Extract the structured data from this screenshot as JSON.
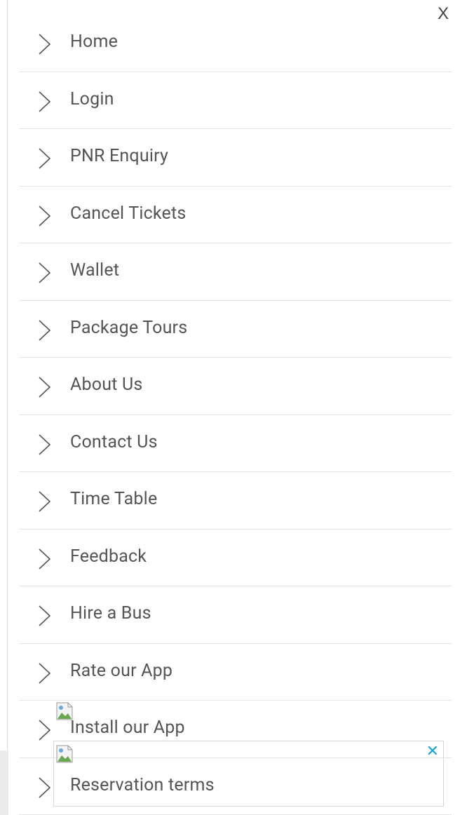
{
  "drawer": {
    "close_label": "X"
  },
  "menu": {
    "items": [
      {
        "label": "Home"
      },
      {
        "label": "Login"
      },
      {
        "label": "PNR Enquiry"
      },
      {
        "label": "Cancel Tickets"
      },
      {
        "label": "Wallet"
      },
      {
        "label": "Package Tours"
      },
      {
        "label": "About Us"
      },
      {
        "label": "Contact Us"
      },
      {
        "label": "Time Table"
      },
      {
        "label": "Feedback"
      },
      {
        "label": "Hire a Bus"
      },
      {
        "label": "Rate our App"
      },
      {
        "label": "Install our App"
      },
      {
        "label": "Reservation terms"
      }
    ]
  },
  "ad": {
    "close_label": "✕"
  },
  "colors": {
    "text": "#545454",
    "divider": "#e3e3e3",
    "chevron": "#555555",
    "ad_close": "#1aa3d9"
  }
}
